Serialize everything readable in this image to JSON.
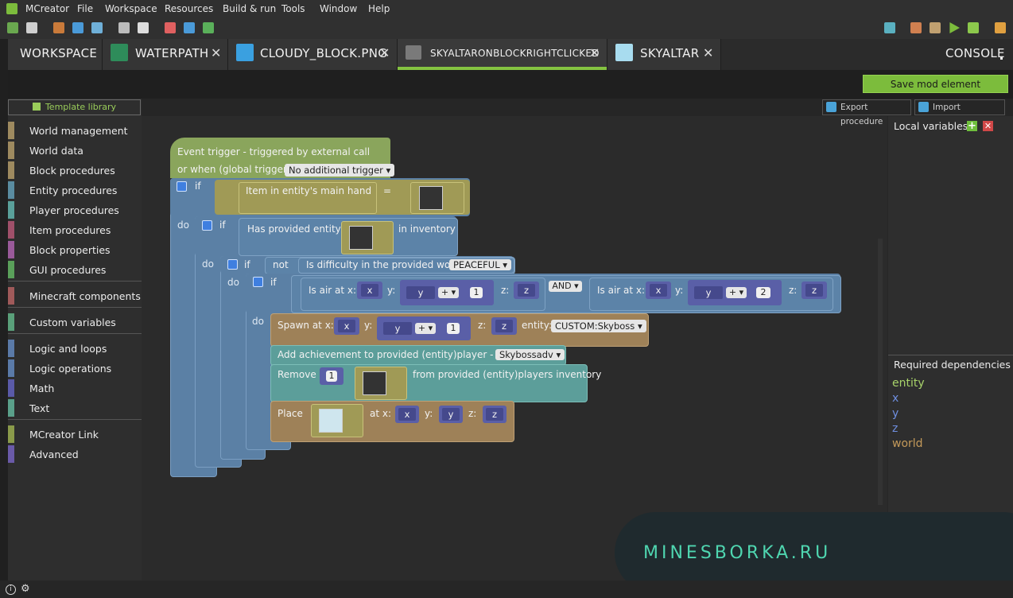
{
  "app": {
    "name": "MCreator"
  },
  "menu": [
    {
      "label": "MCreator",
      "accel": "M"
    },
    {
      "label": "File",
      "accel": "F"
    },
    {
      "label": "Workspace",
      "accel": "W"
    },
    {
      "label": "Resources",
      "accel": "R"
    },
    {
      "label": "Build & run",
      "accel": "B"
    },
    {
      "label": "Tools",
      "accel": "T"
    },
    {
      "label": "Window",
      "accel": "W"
    },
    {
      "label": "Help",
      "accel": "H"
    }
  ],
  "tabs": [
    {
      "label": "WORKSPACE"
    },
    {
      "label": "WATERPATH"
    },
    {
      "label": "CLOUDY_BLOCK.PNG"
    },
    {
      "label": "SKYALTARONBLOCKRIGHTCLICKED",
      "active": true
    },
    {
      "label": "SKYALTAR"
    },
    {
      "label": "CONSOLE"
    }
  ],
  "save_button": "Save mod element",
  "template_library": "Template library",
  "categories": [
    {
      "label": "World management",
      "color": "#9e8a5f"
    },
    {
      "label": "World data",
      "color": "#9e8a5f"
    },
    {
      "label": "Block procedures",
      "color": "#9e8a5f"
    },
    {
      "label": "Entity procedures",
      "color": "#5a8ca0"
    },
    {
      "label": "Player procedures",
      "color": "#5aa09a"
    },
    {
      "label": "Item procedures",
      "color": "#a0506a"
    },
    {
      "label": "Block properties",
      "color": "#9a5a9a"
    },
    {
      "label": "GUI procedures",
      "color": "#5aa05a"
    },
    {
      "label": "Minecraft components",
      "color": "#a05a5a"
    },
    {
      "label": "Custom variables",
      "color": "#5aa07a"
    },
    {
      "label": "Logic and loops",
      "color": "#5a7aa8"
    },
    {
      "label": "Logic operations",
      "color": "#5a7aa8"
    },
    {
      "label": "Math",
      "color": "#5a5aa8"
    },
    {
      "label": "Text",
      "color": "#5aa08a"
    },
    {
      "label": "MCreator Link",
      "color": "#8a9a4a"
    },
    {
      "label": "Advanced",
      "color": "#6a5aa8"
    }
  ],
  "export_procedure": "Export procedure",
  "import_procedure": "Import procedure",
  "local_variables": "Local variables",
  "required_dependencies": "Required dependencies",
  "dependencies": [
    {
      "name": "entity",
      "color": "#a8d36a"
    },
    {
      "name": "x",
      "color": "#6f8fe0"
    },
    {
      "name": "y",
      "color": "#6f8fe0"
    },
    {
      "name": "z",
      "color": "#6f8fe0"
    },
    {
      "name": "world",
      "color": "#c49a5a"
    }
  ],
  "blocks": {
    "trigger_line1": "Event trigger - triggered by external call",
    "trigger_line2": "or when (global trigger):",
    "trigger_value": "No additional trigger",
    "if": "if",
    "do": "do",
    "not": "not",
    "item_main_hand": "Item in entity's main hand",
    "equals": "=",
    "has_provided_entity": "Has provided entity",
    "in_inventory": "in inventory",
    "difficulty": "Is difficulty in the provided world",
    "difficulty_value": "PEACEFUL",
    "is_air_at_x": "Is air at x:",
    "y_label": "y:",
    "z_label": "z:",
    "and": "AND",
    "var_x": "x",
    "var_y": "y",
    "var_z": "z",
    "plus": "+",
    "num_1": "1",
    "num_2": "2",
    "spawn_at_x": "Spawn at x:",
    "entity_label": "entity:",
    "entity_value": "CUSTOM:Skyboss",
    "achievement": "Add achievement to provided (entity)player - ach...",
    "achievement_value": "Skybossadv",
    "remove": "Remove",
    "remove_from": "from provided (entity)players inventory",
    "place": "Place",
    "at_x": "at x:"
  },
  "watermark": "MINESBORKA.RU"
}
